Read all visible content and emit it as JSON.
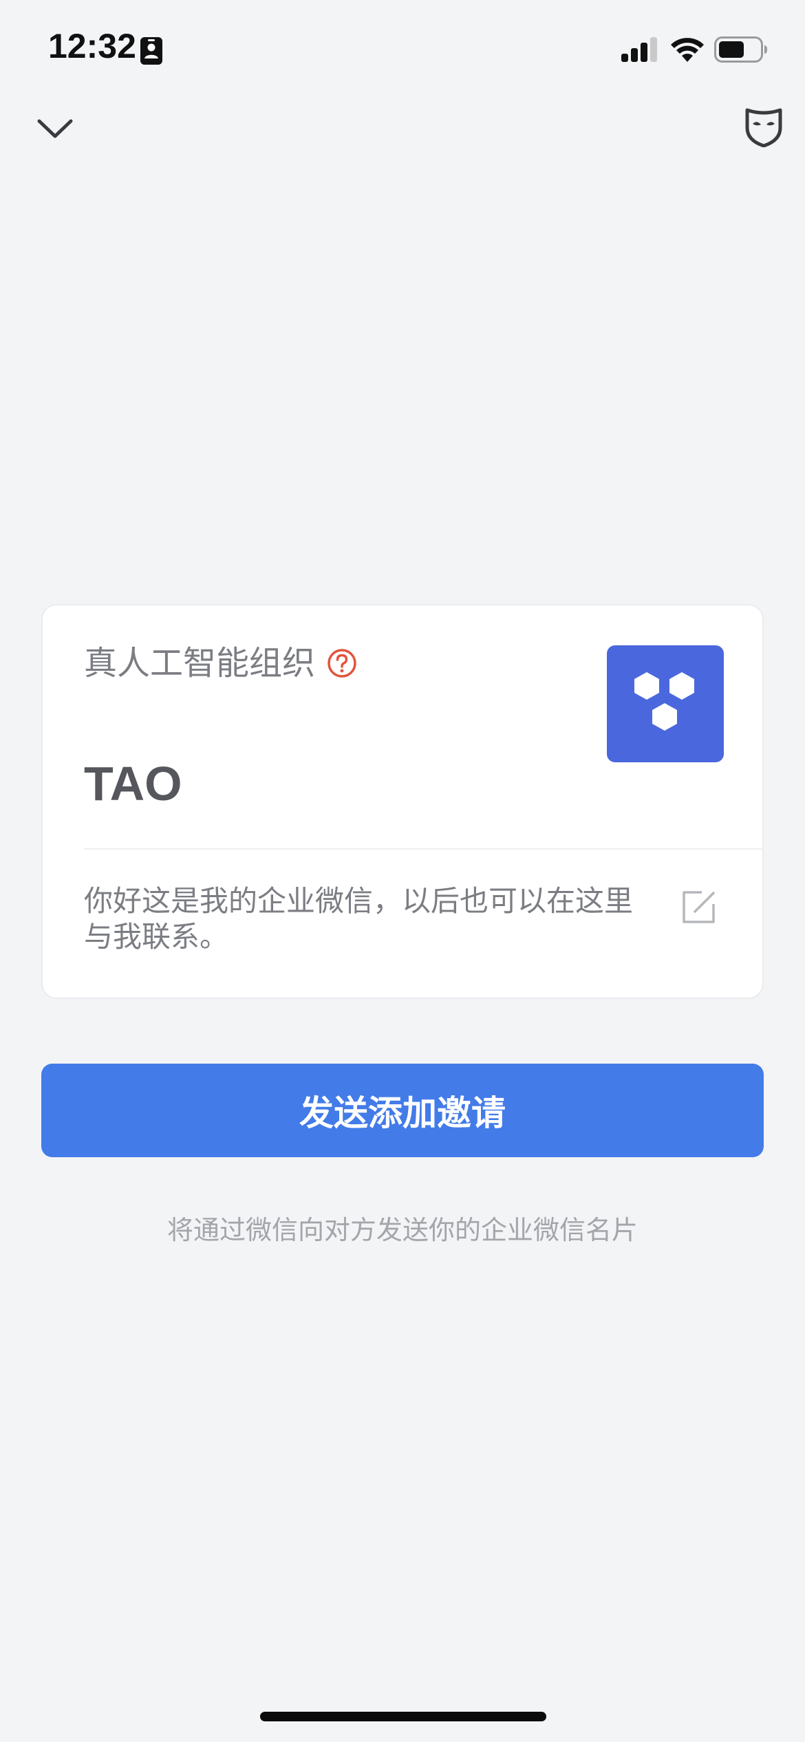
{
  "status_bar": {
    "time": "12:32"
  },
  "nav": {
    "back_icon": "chevron-down-icon",
    "right_icon": "mask-icon"
  },
  "card": {
    "org_name": "真人工智能组织",
    "user_name": "TAO",
    "greeting": "你好这是我的企业微信，以后也可以在这里与我联系。",
    "logo_color": "#4a67dd"
  },
  "actions": {
    "send_button_label": "发送添加邀请",
    "hint": "将通过微信向对方发送你的企业微信名片"
  },
  "colors": {
    "accent": "#437be8",
    "help_icon": "#e2533d",
    "background": "#f3f4f6"
  }
}
